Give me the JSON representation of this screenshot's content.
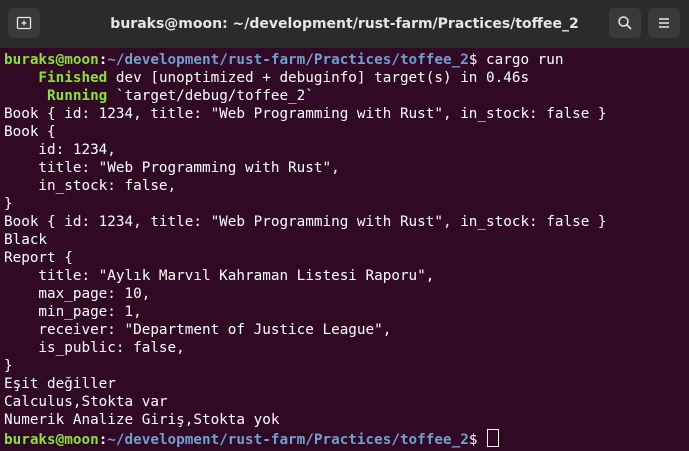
{
  "window": {
    "title": "buraks@moon: ~/development/rust-farm/Practices/toffee_2"
  },
  "titlebar_icons": {
    "new_tab": "new-tab-icon",
    "search": "search-icon",
    "menu": "hamburger-menu-icon"
  },
  "prompt": {
    "user_host": "buraks@moon",
    "colon": ":",
    "path": "~/development/rust-farm/Practices/toffee_2",
    "dollar": "$",
    "command": " cargo run"
  },
  "cargo": {
    "finished_keyword": "    Finished",
    "finished_rest": " dev [unoptimized + debuginfo] target(s) in 0.46s",
    "running_keyword": "     Running",
    "running_rest": " `target/debug/toffee_2`"
  },
  "output_lines": [
    "Book { id: 1234, title: \"Web Programming with Rust\", in_stock: false }",
    "Book {",
    "    id: 1234,",
    "    title: \"Web Programming with Rust\",",
    "    in_stock: false,",
    "}",
    "Book { id: 1234, title: \"Web Programming with Rust\", in_stock: false }",
    "Black",
    "Report {",
    "    title: \"Aylık Marvıl Kahraman Listesi Raporu\",",
    "    max_page: 10,",
    "    min_page: 1,",
    "    receiver: \"Department of Justice League\",",
    "    is_public: false,",
    "}",
    "Eşit değiller",
    "Calculus,Stokta var",
    "Numerik Analize Giriş,Stokta yok"
  ],
  "colors": {
    "background": "#300a24",
    "titlebar": "#2b2b2b",
    "prompt_user": "#8ae234",
    "prompt_path": "#729fcf",
    "text": "#ffffff"
  }
}
